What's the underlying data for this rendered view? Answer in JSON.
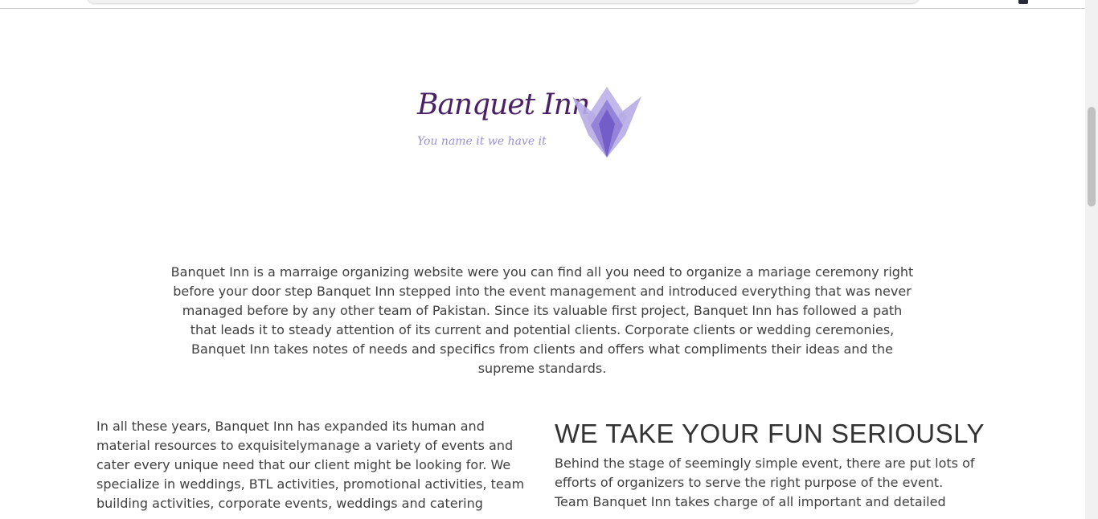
{
  "logo": {
    "title": "Banquet Inn",
    "tagline": "You name it we have it"
  },
  "intro": {
    "text": "Banquet Inn is a marraige organizing website were you can find all you need to organize a mariage ceremony right before your door step Banquet Inn stepped into the event management and introduced everything that was never managed before by any other team of Pakistan. Since its valuable first project, Banquet Inn has followed a path that leads it to steady attention of its current and potential clients. Corporate clients or wedding ceremonies, Banquet Inn takes notes of needs and specifics from clients and offers what compliments their ideas and the supreme standards."
  },
  "left_column": {
    "text": "In all these years, Banquet Inn has expanded its human and material resources to exquisitelymanage a variety of events and cater every unique need that our client might be looking for. We specialize in weddings, BTL activities, promotional activities, team building activities, corporate events, weddings and catering"
  },
  "right_column": {
    "heading": "WE TAKE YOUR FUN SERIOUSLY",
    "text": "Behind the stage of seemingly simple event, there are put lots of efforts of organizers to serve the right purpose of the event. Team Banquet Inn takes charge of all important and detailed"
  },
  "colors": {
    "logo_title": "#4a2066",
    "logo_tagline": "#9b8fd6",
    "logo_mark_light": "#b7ace6",
    "logo_mark_dark": "#6f59c7",
    "body_text": "#404040"
  }
}
